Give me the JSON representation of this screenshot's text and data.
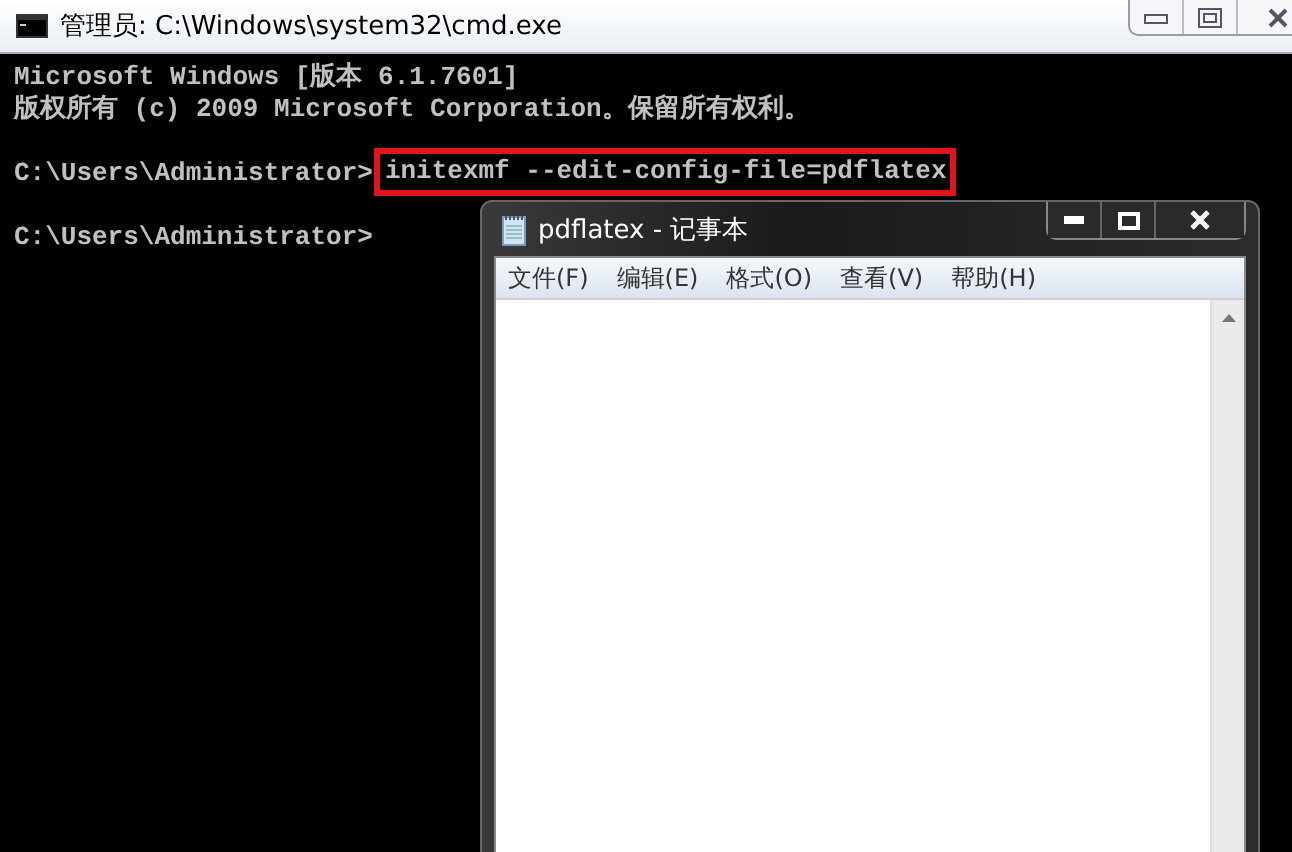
{
  "cmd_window": {
    "title": "管理员: C:\\Windows\\system32\\cmd.exe"
  },
  "console_lines": [
    {
      "kind": "output",
      "text": "Microsoft Windows [版本 6.1.7601]"
    },
    {
      "kind": "output",
      "text": "版权所有 (c) 2009 Microsoft Corporation。保留所有权利。"
    },
    {
      "kind": "blank"
    },
    {
      "kind": "prompt",
      "prompt": "C:\\Users\\Administrator>",
      "command": "initexmf --edit-config-file=pdflatex",
      "highlighted": true
    },
    {
      "kind": "blank"
    },
    {
      "kind": "prompt",
      "prompt": "C:\\Users\\Administrator>"
    }
  ],
  "notepad": {
    "title": "pdflatex - 记事本",
    "menu": [
      "文件(F)",
      "编辑(E)",
      "格式(O)",
      "查看(V)",
      "帮助(H)"
    ]
  }
}
